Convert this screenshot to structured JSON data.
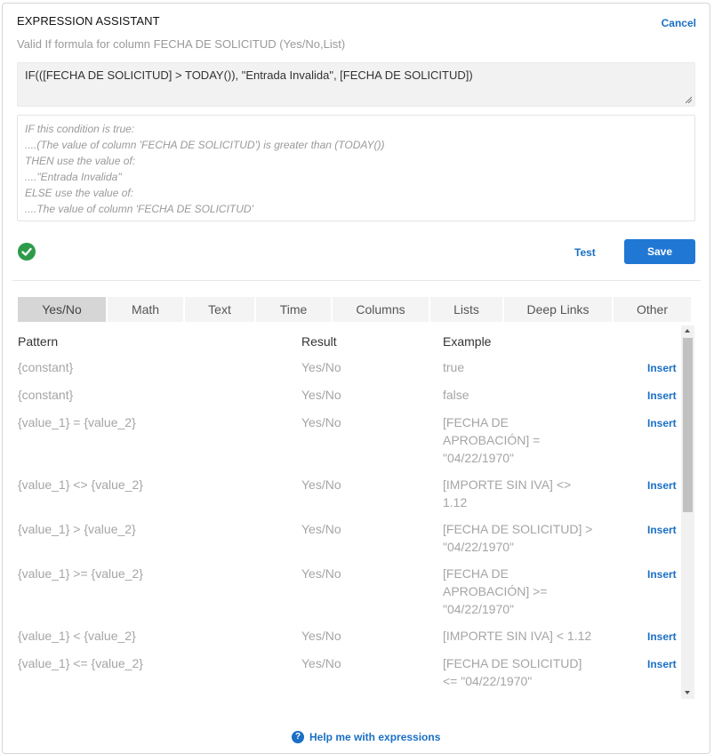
{
  "header": {
    "title": "EXPRESSION ASSISTANT",
    "cancel_label": "Cancel",
    "subtitle": "Valid If formula for column FECHA DE SOLICITUD (Yes/No,List)"
  },
  "formula": "IF(([FECHA DE SOLICITUD] > TODAY()), \"Entrada Invalida\", [FECHA DE SOLICITUD])",
  "explanation": [
    "IF this condition is true:",
    "....(The value of column 'FECHA DE SOLICITUD') is greater than (TODAY())",
    "THEN use the value of:",
    "....\"Entrada Invalida\"",
    "ELSE use the value of:",
    "....The value of column 'FECHA DE SOLICITUD'"
  ],
  "actions": {
    "test_label": "Test",
    "save_label": "Save",
    "status_icon": "check-circle-icon",
    "status_color": "#2e9b4a",
    "accent": "#2178d4"
  },
  "tabs": [
    {
      "label": "Yes/No",
      "active": true
    },
    {
      "label": "Math"
    },
    {
      "label": "Text"
    },
    {
      "label": "Time"
    },
    {
      "label": "Columns"
    },
    {
      "label": "Lists"
    },
    {
      "label": "Deep Links"
    },
    {
      "label": "Other"
    }
  ],
  "table": {
    "headers": {
      "pattern": "Pattern",
      "result": "Result",
      "example": "Example"
    },
    "insert_label": "Insert",
    "rows": [
      {
        "pattern": "{constant}",
        "result": "Yes/No",
        "example": [
          "true"
        ]
      },
      {
        "pattern": "{constant}",
        "result": "Yes/No",
        "example": [
          "false"
        ]
      },
      {
        "pattern": "{value_1} = {value_2}",
        "result": "Yes/No",
        "example": [
          "[FECHA DE",
          "APROBACIÓN] =",
          "\"04/22/1970\""
        ]
      },
      {
        "pattern": "{value_1} <> {value_2}",
        "result": "Yes/No",
        "example": [
          "[IMPORTE SIN IVA] <>",
          "1.12"
        ]
      },
      {
        "pattern": "{value_1} > {value_2}",
        "result": "Yes/No",
        "example": [
          "[FECHA DE SOLICITUD] >",
          "\"04/22/1970\""
        ]
      },
      {
        "pattern": "{value_1} >= {value_2}",
        "result": "Yes/No",
        "example": [
          "[FECHA DE",
          "APROBACIÓN] >=",
          "\"04/22/1970\""
        ]
      },
      {
        "pattern": "{value_1} < {value_2}",
        "result": "Yes/No",
        "example": [
          "[IMPORTE SIN IVA] < 1.12"
        ]
      },
      {
        "pattern": "{value_1} <= {value_2}",
        "result": "Yes/No",
        "example": [
          "[FECHA DE SOLICITUD]",
          "<= \"04/22/1970\""
        ]
      }
    ]
  },
  "footer": {
    "help_label": "Help me with expressions"
  }
}
